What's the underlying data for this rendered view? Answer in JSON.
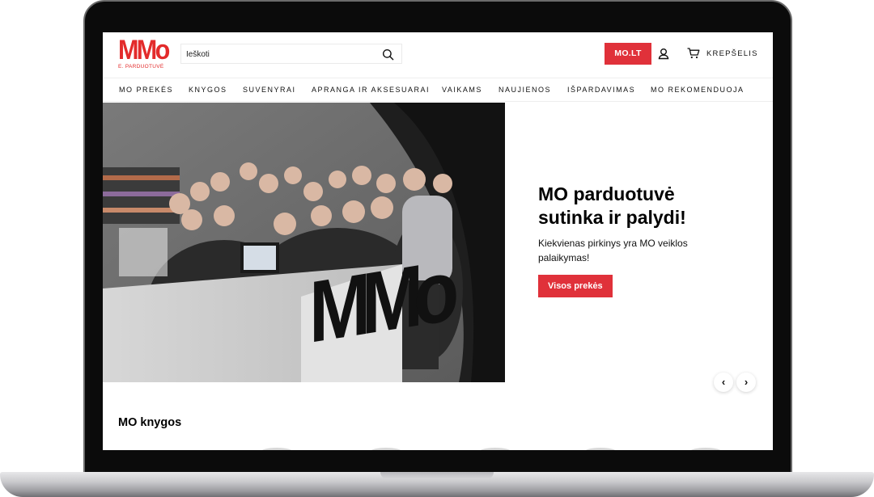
{
  "header": {
    "logo_text": "MMo",
    "logo_subtitle": "E. PARDUOTUVĖ",
    "search_placeholder": "Ieškoti",
    "molt_label": "MO.LT",
    "cart_label": "KREPŠELIS"
  },
  "nav": {
    "items": [
      {
        "label": "MO PREKĖS"
      },
      {
        "label": "KNYGOS"
      },
      {
        "label": "SUVENYRAI"
      },
      {
        "label": "APRANGA IR AKSESUARAI"
      },
      {
        "label": "VAIKAMS"
      },
      {
        "label": "NAUJIENOS"
      },
      {
        "label": "IŠPARDAVIMAS"
      },
      {
        "label": "MO REKOMENDUOJA"
      }
    ]
  },
  "hero": {
    "title": "MO parduotuvė sutinka ir palydi!",
    "description": "Kiekvienas pirkinys yra MO veiklos palaikymas!",
    "button_label": "Visos prekės",
    "prev_arrow": "‹",
    "next_arrow": "›",
    "counter_logo_text": "MMo"
  },
  "section": {
    "title": "MO knygos"
  },
  "colors": {
    "accent": "#e0313a",
    "logo": "#e32b2b"
  }
}
